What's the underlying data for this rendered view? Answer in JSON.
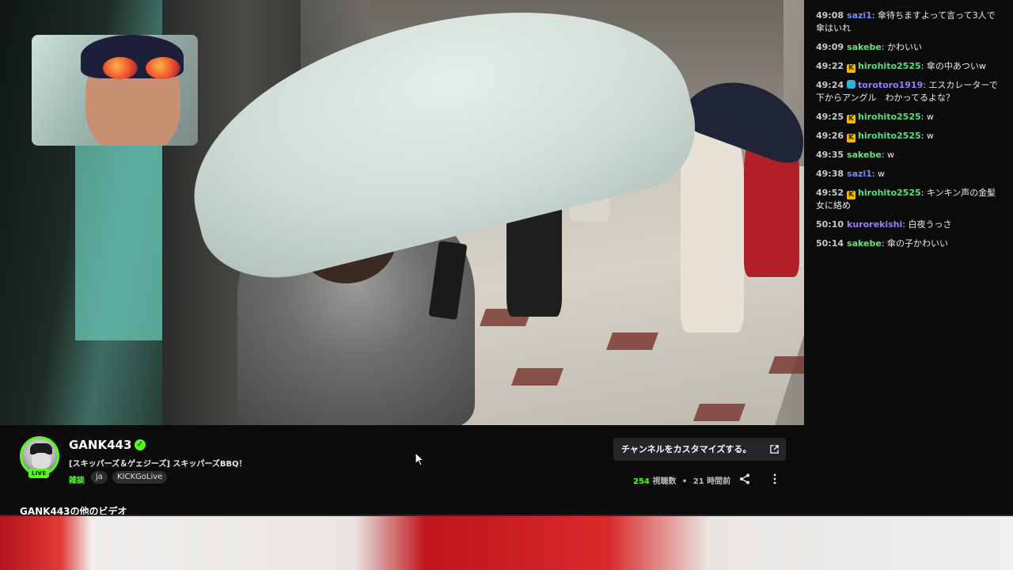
{
  "chat": {
    "messages": [
      {
        "time": "49:08",
        "user": "sazi1",
        "user_color": "#6f8cff",
        "badge": "",
        "text": "傘待ちますよって言って3人で傘はいれ"
      },
      {
        "time": "49:09",
        "user": "sakebe",
        "user_color": "#5fe37f",
        "badge": "",
        "text": "かわいい"
      },
      {
        "time": "49:22",
        "user": "hirohito2525",
        "user_color": "#4de27a",
        "badge": "kick",
        "text": "傘の中あついw"
      },
      {
        "time": "49:24",
        "user": "torotoro1919",
        "user_color": "#9b7bff",
        "badge": "mod",
        "text": "エスカレーターで下からアングル　わかってるよな？"
      },
      {
        "time": "49:25",
        "user": "hirohito2525",
        "user_color": "#4de27a",
        "badge": "kick",
        "text": "w"
      },
      {
        "time": "49:26",
        "user": "hirohito2525",
        "user_color": "#4de27a",
        "badge": "kick",
        "text": "w"
      },
      {
        "time": "49:35",
        "user": "sakebe",
        "user_color": "#5fe37f",
        "badge": "",
        "text": "w"
      },
      {
        "time": "49:38",
        "user": "sazi1",
        "user_color": "#6f8cff",
        "badge": "",
        "text": "w"
      },
      {
        "time": "49:52",
        "user": "hirohito2525",
        "user_color": "#4de27a",
        "badge": "kick",
        "text": "キンキン声の金髪女に絡め"
      },
      {
        "time": "50:10",
        "user": "kurorekishi",
        "user_color": "#9b7bff",
        "badge": "",
        "text": "白夜うっさ"
      },
      {
        "time": "50:14",
        "user": "sakebe",
        "user_color": "#5fe37f",
        "badge": "",
        "text": "傘の子かわいい"
      }
    ]
  },
  "channel": {
    "name": "GANK443",
    "live_label": "LIVE",
    "verified_icon": "✓",
    "stream_title": "[スキッパーズ＆ゲェジーズ] スキッパーズBBQ！",
    "category": "雑談",
    "tags": [
      "ja",
      "KICKGoLive"
    ],
    "customize_label": "チャンネルをカスタマイズする。",
    "viewers": "254",
    "viewers_label": "視聴数",
    "separator": "•",
    "time_ago": "21 時間前",
    "other_videos": "GANK443の他のビデオ"
  },
  "colors": {
    "accent": "#53fc18",
    "background": "#0b0b0c",
    "button_bg": "#242528"
  },
  "icons": {
    "verified": "verified-check-icon",
    "external": "external-link-icon",
    "share": "share-icon",
    "more": "more-vertical-icon"
  }
}
